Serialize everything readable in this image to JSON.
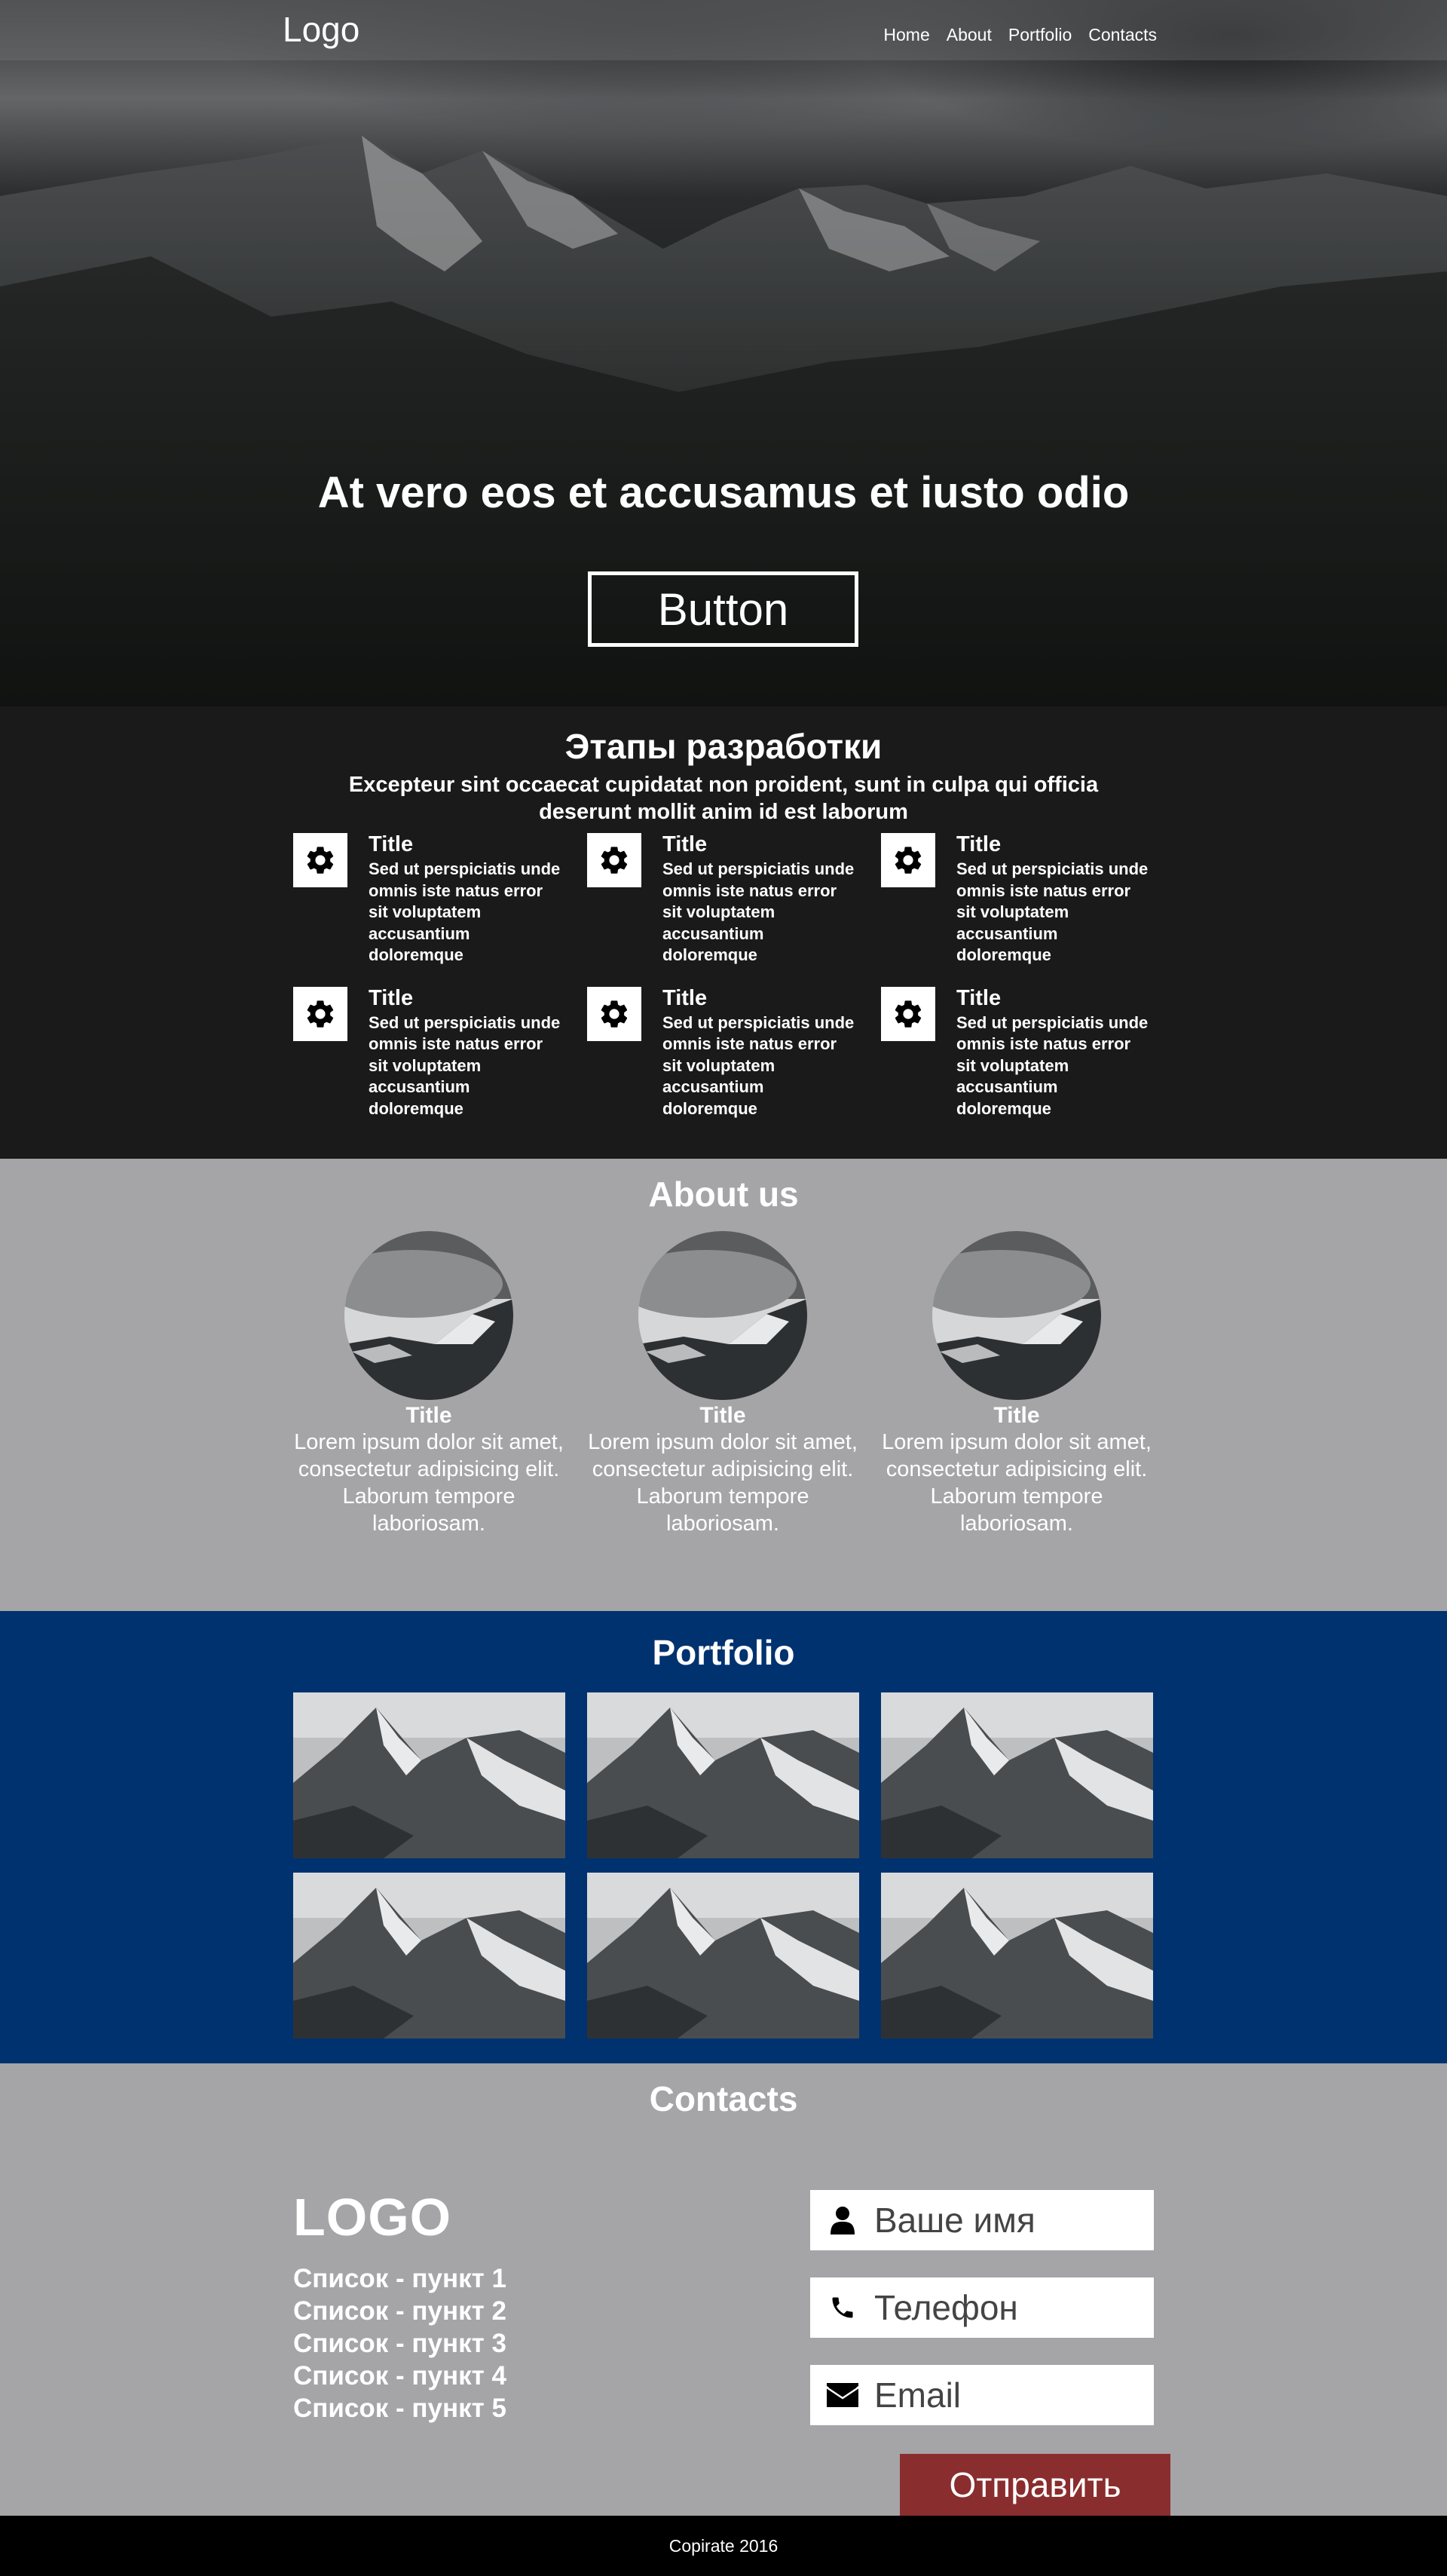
{
  "header": {
    "logo": "Logo",
    "nav": [
      "Home",
      "About",
      "Portfolio",
      "Contacts"
    ]
  },
  "hero": {
    "title": "At vero eos et accusamus et iusto odio",
    "button": "Button"
  },
  "stages": {
    "title": "Этапы разработки",
    "subtitle": "Excepteur sint occaecat cupidatat non proident, sunt in culpa qui officia deserunt mollit anim id est laborum",
    "items": [
      {
        "title": "Title",
        "text": "Sed ut perspiciatis unde omnis iste natus error sit voluptatem accusantium doloremque",
        "icon": "gear-icon"
      },
      {
        "title": "Title",
        "text": "Sed ut perspiciatis unde omnis iste natus error sit voluptatem accusantium doloremque",
        "icon": "gear-icon"
      },
      {
        "title": "Title",
        "text": "Sed ut perspiciatis unde omnis iste natus error sit voluptatem accusantium doloremque",
        "icon": "gear-icon"
      },
      {
        "title": "Title",
        "text": "Sed ut perspiciatis unde omnis iste natus error sit voluptatem accusantium doloremque",
        "icon": "gear-icon"
      },
      {
        "title": "Title",
        "text": "Sed ut perspiciatis unde omnis iste natus error sit voluptatem accusantium doloremque",
        "icon": "gear-icon"
      },
      {
        "title": "Title",
        "text": "Sed ut perspiciatis unde omnis iste natus error sit voluptatem accusantium doloremque",
        "icon": "gear-icon"
      }
    ]
  },
  "about": {
    "title": "About us",
    "members": [
      {
        "title": "Title",
        "text": "Lorem ipsum dolor sit amet, consectetur adipisicing elit. Laborum tempore laboriosam."
      },
      {
        "title": "Title",
        "text": "Lorem ipsum dolor sit amet, consectetur adipisicing elit. Laborum tempore laboriosam."
      },
      {
        "title": "Title",
        "text": "Lorem ipsum dolor sit amet, consectetur adipisicing elit. Laborum tempore laboriosam."
      }
    ]
  },
  "portfolio": {
    "title": "Portfolio",
    "item_count": 6
  },
  "contacts": {
    "title": "Contacts",
    "logo": "LOGO",
    "list": [
      "Список - пункт 1",
      "Список - пункт 2",
      "Список - пункт 3",
      "Список - пункт 4",
      "Список - пункт 5"
    ],
    "form": {
      "name_placeholder": "Ваше имя",
      "phone_placeholder": "Телефон",
      "email_placeholder": "Email",
      "submit": "Отправить"
    }
  },
  "footer": {
    "copyright": "Copirate 2016"
  },
  "colors": {
    "stages_bg": "#1a1a1a",
    "about_bg": "#a5a4a7",
    "portfolio_bg": "#00326f",
    "contacts_bg": "#a5a4a7",
    "submit_bg": "#8a2d2e",
    "footer_bg": "#000000"
  }
}
